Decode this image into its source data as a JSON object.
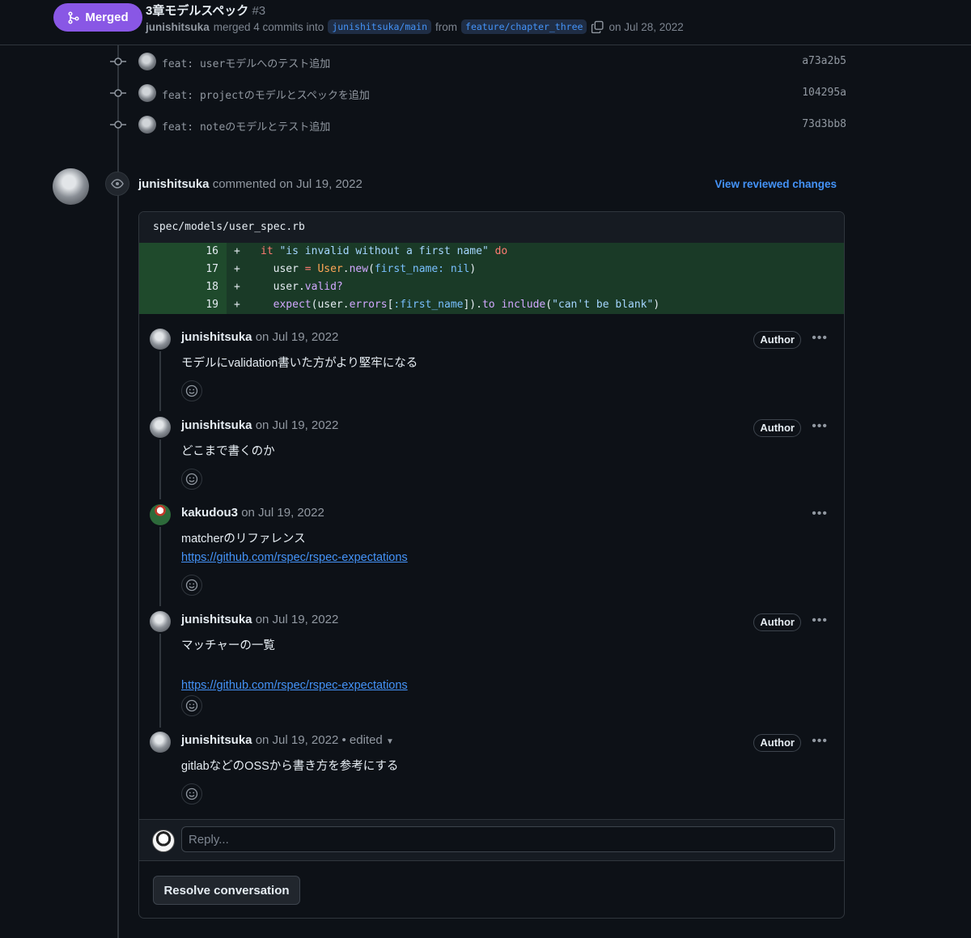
{
  "header": {
    "status_label": "Merged",
    "title": "3章モデルスペック",
    "number": "#3",
    "author": "junishitsuka",
    "merged_text": "merged 4 commits into",
    "base_branch": "junishitsuka/main",
    "from_text": "from",
    "head_branch": "feature/chapter_three",
    "date_text": "on Jul 28, 2022"
  },
  "commits": [
    {
      "message": "feat: userモデルへのテスト追加",
      "sha": "a73a2b5"
    },
    {
      "message": "feat: projectのモデルとスペックを追加",
      "sha": "104295a"
    },
    {
      "message": "feat: noteのモデルとテスト追加",
      "sha": "73d3bb8"
    }
  ],
  "review": {
    "author": "junishitsuka",
    "action_text": "commented on Jul 19, 2022",
    "view_changes_label": "View reviewed changes",
    "file_path": "spec/models/user_spec.rb",
    "diff_lines": [
      {
        "num": "16",
        "sign": "+",
        "code": "  it \"is invalid without a first name\" do"
      },
      {
        "num": "17",
        "sign": "+",
        "code": "    user = User.new(first_name: nil)"
      },
      {
        "num": "18",
        "sign": "+",
        "code": "    user.valid?"
      },
      {
        "num": "19",
        "sign": "+",
        "code": "    expect(user.errors[:first_name]).to include(\"can't be blank\")"
      }
    ]
  },
  "comments": [
    {
      "author": "junishitsuka",
      "date": "on Jul 19, 2022",
      "badge": "Author",
      "body": "モデルにvalidation書いた方がより堅牢になる"
    },
    {
      "author": "junishitsuka",
      "date": "on Jul 19, 2022",
      "badge": "Author",
      "body": "どこまで書くのか"
    },
    {
      "author": "kakudou3",
      "date": "on Jul 19, 2022",
      "body": "matcherのリファレンス",
      "link": "https://github.com/rspec/rspec-expectations"
    },
    {
      "author": "junishitsuka",
      "date": "on Jul 19, 2022",
      "badge": "Author",
      "body": "マッチャーの一覧",
      "link": "https://github.com/rspec/rspec-expectations"
    },
    {
      "author": "junishitsuka",
      "date": "on Jul 19, 2022",
      "edited": "• edited",
      "badge": "Author",
      "body": "gitlabなどのOSSから書き方を参考にする"
    }
  ],
  "reply": {
    "placeholder": "Reply..."
  },
  "resolve_label": "Resolve conversation",
  "colors": {
    "merged": "#8957e5",
    "link": "#4493f8",
    "diff_add_bg": "#1a3a27"
  }
}
